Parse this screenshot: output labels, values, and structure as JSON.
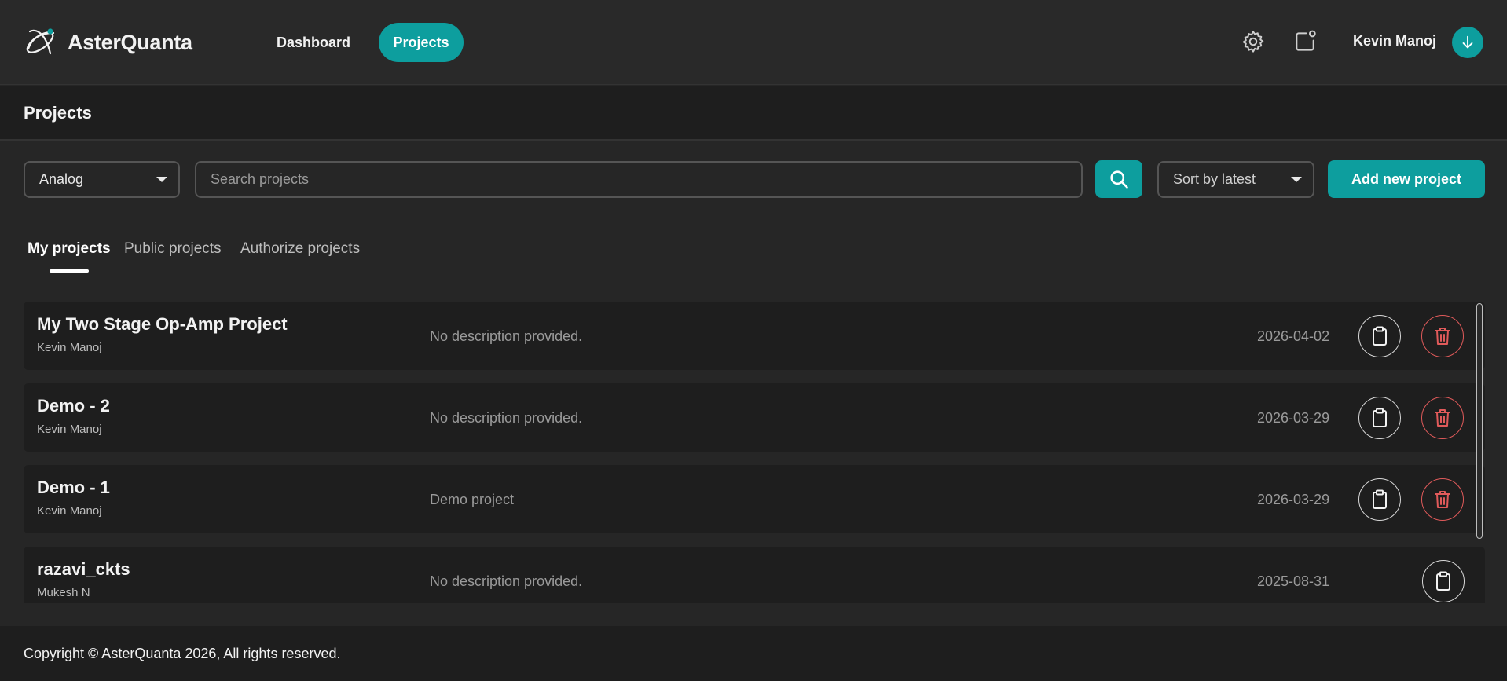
{
  "app": {
    "name": "AsterQuanta"
  },
  "nav": {
    "dashboard": "Dashboard",
    "projects": "Projects"
  },
  "user": {
    "name": "Kevin Manoj"
  },
  "icons": {
    "logo": "atom-logo-icon",
    "settings": "gear-icon",
    "notifications": "notification-icon",
    "avatar": "arrow-down-icon",
    "search": "search-icon",
    "copy": "clipboard-icon",
    "delete": "trash-icon"
  },
  "colors": {
    "accent": "#0d9e9e",
    "danger": "#e05a5a"
  },
  "page": {
    "title": "Projects"
  },
  "filters": {
    "category": "Analog",
    "search_placeholder": "Search projects",
    "sort": "Sort by latest",
    "add_button": "Add new project"
  },
  "tabs": [
    {
      "label": "My projects",
      "active": true
    },
    {
      "label": "Public projects",
      "active": false
    },
    {
      "label": "Authorize projects",
      "active": false
    }
  ],
  "projects": [
    {
      "name": "My Two Stage Op-Amp Project",
      "owner": "Kevin Manoj",
      "description": "No description provided.",
      "date": "2026-04-02",
      "can_delete": true
    },
    {
      "name": "Demo - 2",
      "owner": "Kevin Manoj",
      "description": "No description provided.",
      "date": "2026-03-29",
      "can_delete": true
    },
    {
      "name": "Demo - 1",
      "owner": "Kevin Manoj",
      "description": "Demo project",
      "date": "2026-03-29",
      "can_delete": true
    },
    {
      "name": "razavi_ckts",
      "owner": "Mukesh N",
      "description": "No description provided.",
      "date": "2025-08-31",
      "can_delete": false
    }
  ],
  "footer": {
    "copyright": "Copyright © AsterQuanta 2026, All rights reserved."
  }
}
